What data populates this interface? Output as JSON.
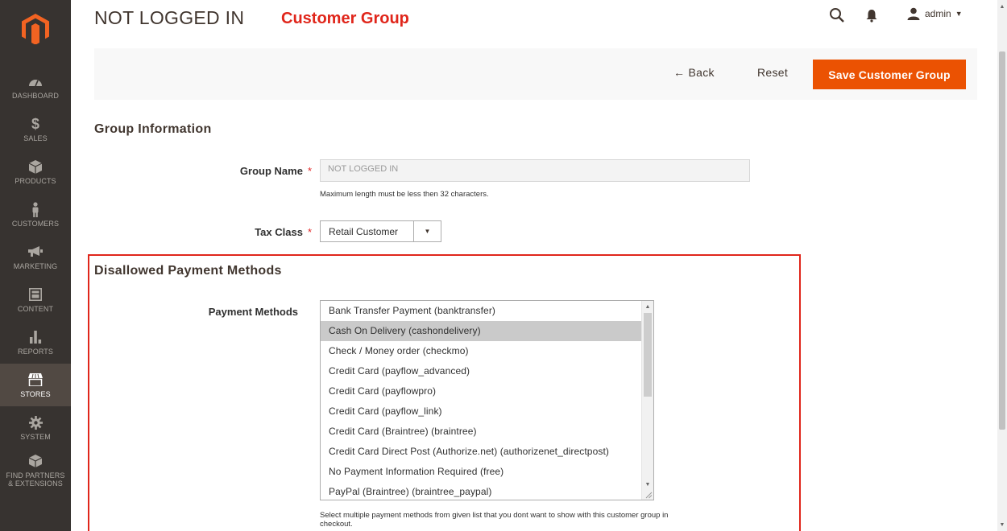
{
  "header": {
    "title": "NOT LOGGED IN",
    "annotation": "Customer Group",
    "user_name": "admin",
    "user_caret": "▼"
  },
  "sidebar": {
    "items": [
      {
        "label": "DASHBOARD",
        "icon": "dashboard-icon"
      },
      {
        "label": "SALES",
        "icon": "dollar-icon"
      },
      {
        "label": "PRODUCTS",
        "icon": "cube-icon"
      },
      {
        "label": "CUSTOMERS",
        "icon": "person-icon"
      },
      {
        "label": "MARKETING",
        "icon": "megaphone-icon"
      },
      {
        "label": "CONTENT",
        "icon": "layout-icon"
      },
      {
        "label": "REPORTS",
        "icon": "bar-chart-icon"
      },
      {
        "label": "STORES",
        "icon": "storefront-icon"
      },
      {
        "label": "SYSTEM",
        "icon": "gear-icon"
      },
      {
        "label_line1": "FIND PARTNERS",
        "label_line2": "& EXTENSIONS",
        "icon": "cube-stack-icon"
      }
    ]
  },
  "actions": {
    "back_label": "← Back",
    "reset_label": "Reset",
    "save_label": "Save Customer Group"
  },
  "group_info": {
    "section_title": "Group Information",
    "group_name_label": "Group Name",
    "required_mark": "*",
    "group_name_value": "NOT LOGGED IN",
    "group_name_note": "Maximum length must be less then 32 characters.",
    "tax_class_label": "Tax Class",
    "tax_class_value": "Retail Customer",
    "tax_class_arrow": "▼"
  },
  "payment": {
    "section_title": "Disallowed Payment Methods",
    "label": "Payment Methods",
    "options": [
      "Bank Transfer Payment (banktransfer)",
      "Cash On Delivery (cashondelivery)",
      "Check / Money order (checkmo)",
      "Credit Card (payflow_advanced)",
      "Credit Card (payflowpro)",
      "Credit Card (payflow_link)",
      "Credit Card (Braintree) (braintree)",
      "Credit Card Direct Post (Authorize.net) (authorizenet_directpost)",
      "No Payment Information Required (free)",
      "PayPal (Braintree) (braintree_paypal)"
    ],
    "selected_index": 1,
    "note_line1": "Select multiple payment methods from given list that you dont want to show with this customer group in",
    "note_line2": "checkout."
  },
  "colors": {
    "sidebar_bg": "#373330",
    "sidebar_active": "#514943",
    "accent": "#eb5202",
    "annotation_red": "#e0261b"
  }
}
